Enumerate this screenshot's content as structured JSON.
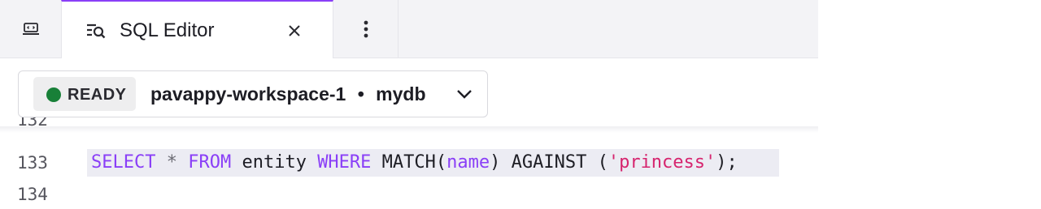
{
  "tabs": {
    "home_icon": "monitor-code-icon",
    "active_tab": {
      "icon": "query-editor-icon",
      "label": "SQL Editor",
      "close_icon": "close-icon"
    },
    "menu_icon": "kebab-menu-icon"
  },
  "toolbar": {
    "status": "READY",
    "status_color": "#188038",
    "workspace": "pavappy-workspace-1",
    "separator": "•",
    "database": "mydb",
    "chevron_icon": "chevron-down-icon"
  },
  "editor": {
    "lines": [
      {
        "number": "132",
        "code": ""
      },
      {
        "number": "133",
        "tokens": {
          "t1": "SELECT",
          "t2": " ",
          "t3": "*",
          "t4": " ",
          "t5": "FROM",
          "t6": " entity ",
          "t7": "WHERE",
          "t8": " MATCH(",
          "t9": "name",
          "t10": ") AGAINST (",
          "t11": "'princess'",
          "t12": ");"
        }
      },
      {
        "number": "134",
        "code": ""
      }
    ]
  },
  "colors": {
    "accent": "#8a3ff7",
    "string": "#d6246e"
  }
}
